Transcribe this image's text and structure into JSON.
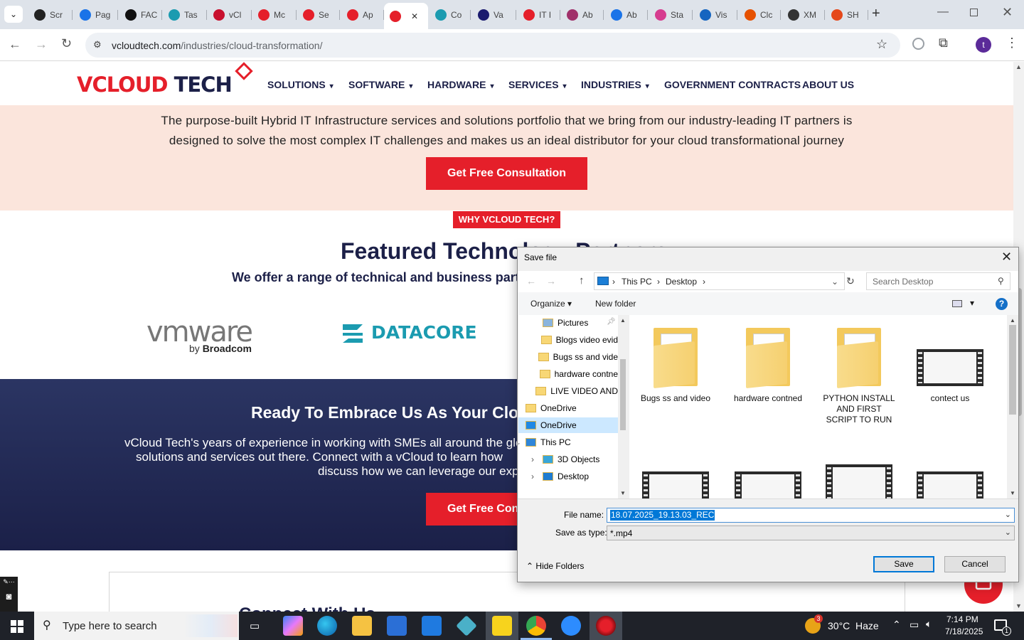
{
  "browser": {
    "tabs": [
      {
        "label": "Scr",
        "color": "#222"
      },
      {
        "label": "Pag",
        "color": "#1a73e8"
      },
      {
        "label": "FAC",
        "color": "#111"
      },
      {
        "label": "Tas",
        "color": "#1b9bb0"
      },
      {
        "label": "vCl",
        "color": "#c8102e"
      },
      {
        "label": "Mc",
        "color": "#e51f2a"
      },
      {
        "label": "Se",
        "color": "#e51f2a"
      },
      {
        "label": "Ap",
        "color": "#e51f2a"
      },
      {
        "label": "",
        "color": "#e51f2a"
      },
      {
        "label": "Co",
        "color": "#1b9bb0"
      },
      {
        "label": "Va",
        "color": "#1a1a6e"
      },
      {
        "label": "IT I",
        "color": "#e51f2a"
      },
      {
        "label": "Ab",
        "color": "#a0306a"
      },
      {
        "label": "Ab",
        "color": "#1a73e8"
      },
      {
        "label": "Sta",
        "color": "#d63c8f"
      },
      {
        "label": "Vis",
        "color": "#1565c0"
      },
      {
        "label": "Clc",
        "color": "#e65100"
      },
      {
        "label": "XM",
        "color": "#333"
      },
      {
        "label": "SH",
        "color": "#e5481b"
      }
    ],
    "url_host": "vcloudtech.com",
    "url_path": "/industries/cloud-transformation/",
    "profile_initial": "t"
  },
  "site": {
    "logo_v": "V",
    "logo_cloud": "CLOUD",
    "logo_tech": "TECH",
    "nav": [
      {
        "label": "SOLUTIONS",
        "caret": "▾"
      },
      {
        "label": "SOFTWARE",
        "caret": "▾"
      },
      {
        "label": "HARDWARE",
        "caret": "▾"
      },
      {
        "label": "SERVICES",
        "caret": "▾"
      },
      {
        "label": "INDUSTRIES",
        "caret": "▾"
      },
      {
        "label": "GOVERNMENT CONTRACTS",
        "caret": ""
      },
      {
        "label": "ABOUT US",
        "caret": ""
      }
    ],
    "hero_line1": "The purpose-built Hybrid IT Infrastructure services and solutions portfolio that we bring from our industry-leading IT partners is",
    "hero_line2": "designed to solve the most complex IT challenges and makes us an ideal distributor for your cloud transformational journey",
    "cta1": "Get Free Consultation",
    "why_badge": "WHY VCLOUD TECH?",
    "featured_title": "Featured Technology Partners",
    "offer_text": "We offer a range of technical and business partnerships",
    "vmware": "vmware",
    "vmware_by": "by",
    "vmware_broadcom": "Broadcom",
    "datacore": "DATACORE",
    "band_title": "Ready To Embrace Us As Your Cloud Partner?",
    "band_line1": "vCloud Tech's years of experience in working with SMEs all around the globe",
    "band_line2": "solutions and services out there. Connect with a vCloud to learn how",
    "band_line3": "discuss how we can leverage our expertise",
    "cta2": "Get Free Consultation",
    "lower_heading": "Connect With Us"
  },
  "dialog": {
    "title": "Save file",
    "crumbs": [
      "This PC",
      "Desktop"
    ],
    "search_placeholder": "Search Desktop",
    "organize": "Organize",
    "new_folder": "New folder",
    "help": "?",
    "tree": [
      {
        "label": "Pictures",
        "indent": 1,
        "kind": "pictures",
        "expander": ""
      },
      {
        "label": "Blogs video evid",
        "indent": 1,
        "kind": "folder",
        "expander": ""
      },
      {
        "label": "Bugs ss and  vide",
        "indent": 1,
        "kind": "folder",
        "expander": ""
      },
      {
        "label": "hardware contne",
        "indent": 1,
        "kind": "folder",
        "expander": ""
      },
      {
        "label": "LIVE VIDEO AND",
        "indent": 1,
        "kind": "folder",
        "expander": ""
      },
      {
        "label": "OneDrive",
        "indent": 0,
        "kind": "folder",
        "expander": "›"
      },
      {
        "label": "OneDrive",
        "indent": 0,
        "kind": "cloud",
        "expander": "›",
        "selected": true
      },
      {
        "label": "This PC",
        "indent": 0,
        "kind": "pc",
        "expander": "⌄"
      },
      {
        "label": "3D Objects",
        "indent": 1,
        "kind": "3d",
        "expander": "›"
      },
      {
        "label": "Desktop",
        "indent": 1,
        "kind": "desktop",
        "expander": "›"
      }
    ],
    "files": [
      {
        "name": "Bugs ss and video",
        "kind": "folder"
      },
      {
        "name": "hardware contned",
        "kind": "folder"
      },
      {
        "name": "PYTHON INSTALL AND FIRST SCRIPT TO RUN",
        "kind": "folder"
      },
      {
        "name": "contect us",
        "kind": "video"
      }
    ],
    "file_name_label": "File name:",
    "file_name_value": "18.07.2025_19.13.03_REC",
    "save_type_label": "Save as type:",
    "save_type_value": "*.mp4",
    "hide_folders": "Hide Folders",
    "save": "Save",
    "cancel": "Cancel"
  },
  "taskbar": {
    "search_placeholder": "Type here to search",
    "weather_temp": "30°C",
    "weather_desc": "Haze",
    "weather_badge": "3",
    "time": "7:14 PM",
    "date": "7/18/2025",
    "notification_count": "1"
  },
  "colors": {
    "brand_red": "#e51f2a",
    "brand_navy": "#1c2048",
    "hero_bg": "#fbe5dc",
    "taskbar": "#1f2229"
  }
}
